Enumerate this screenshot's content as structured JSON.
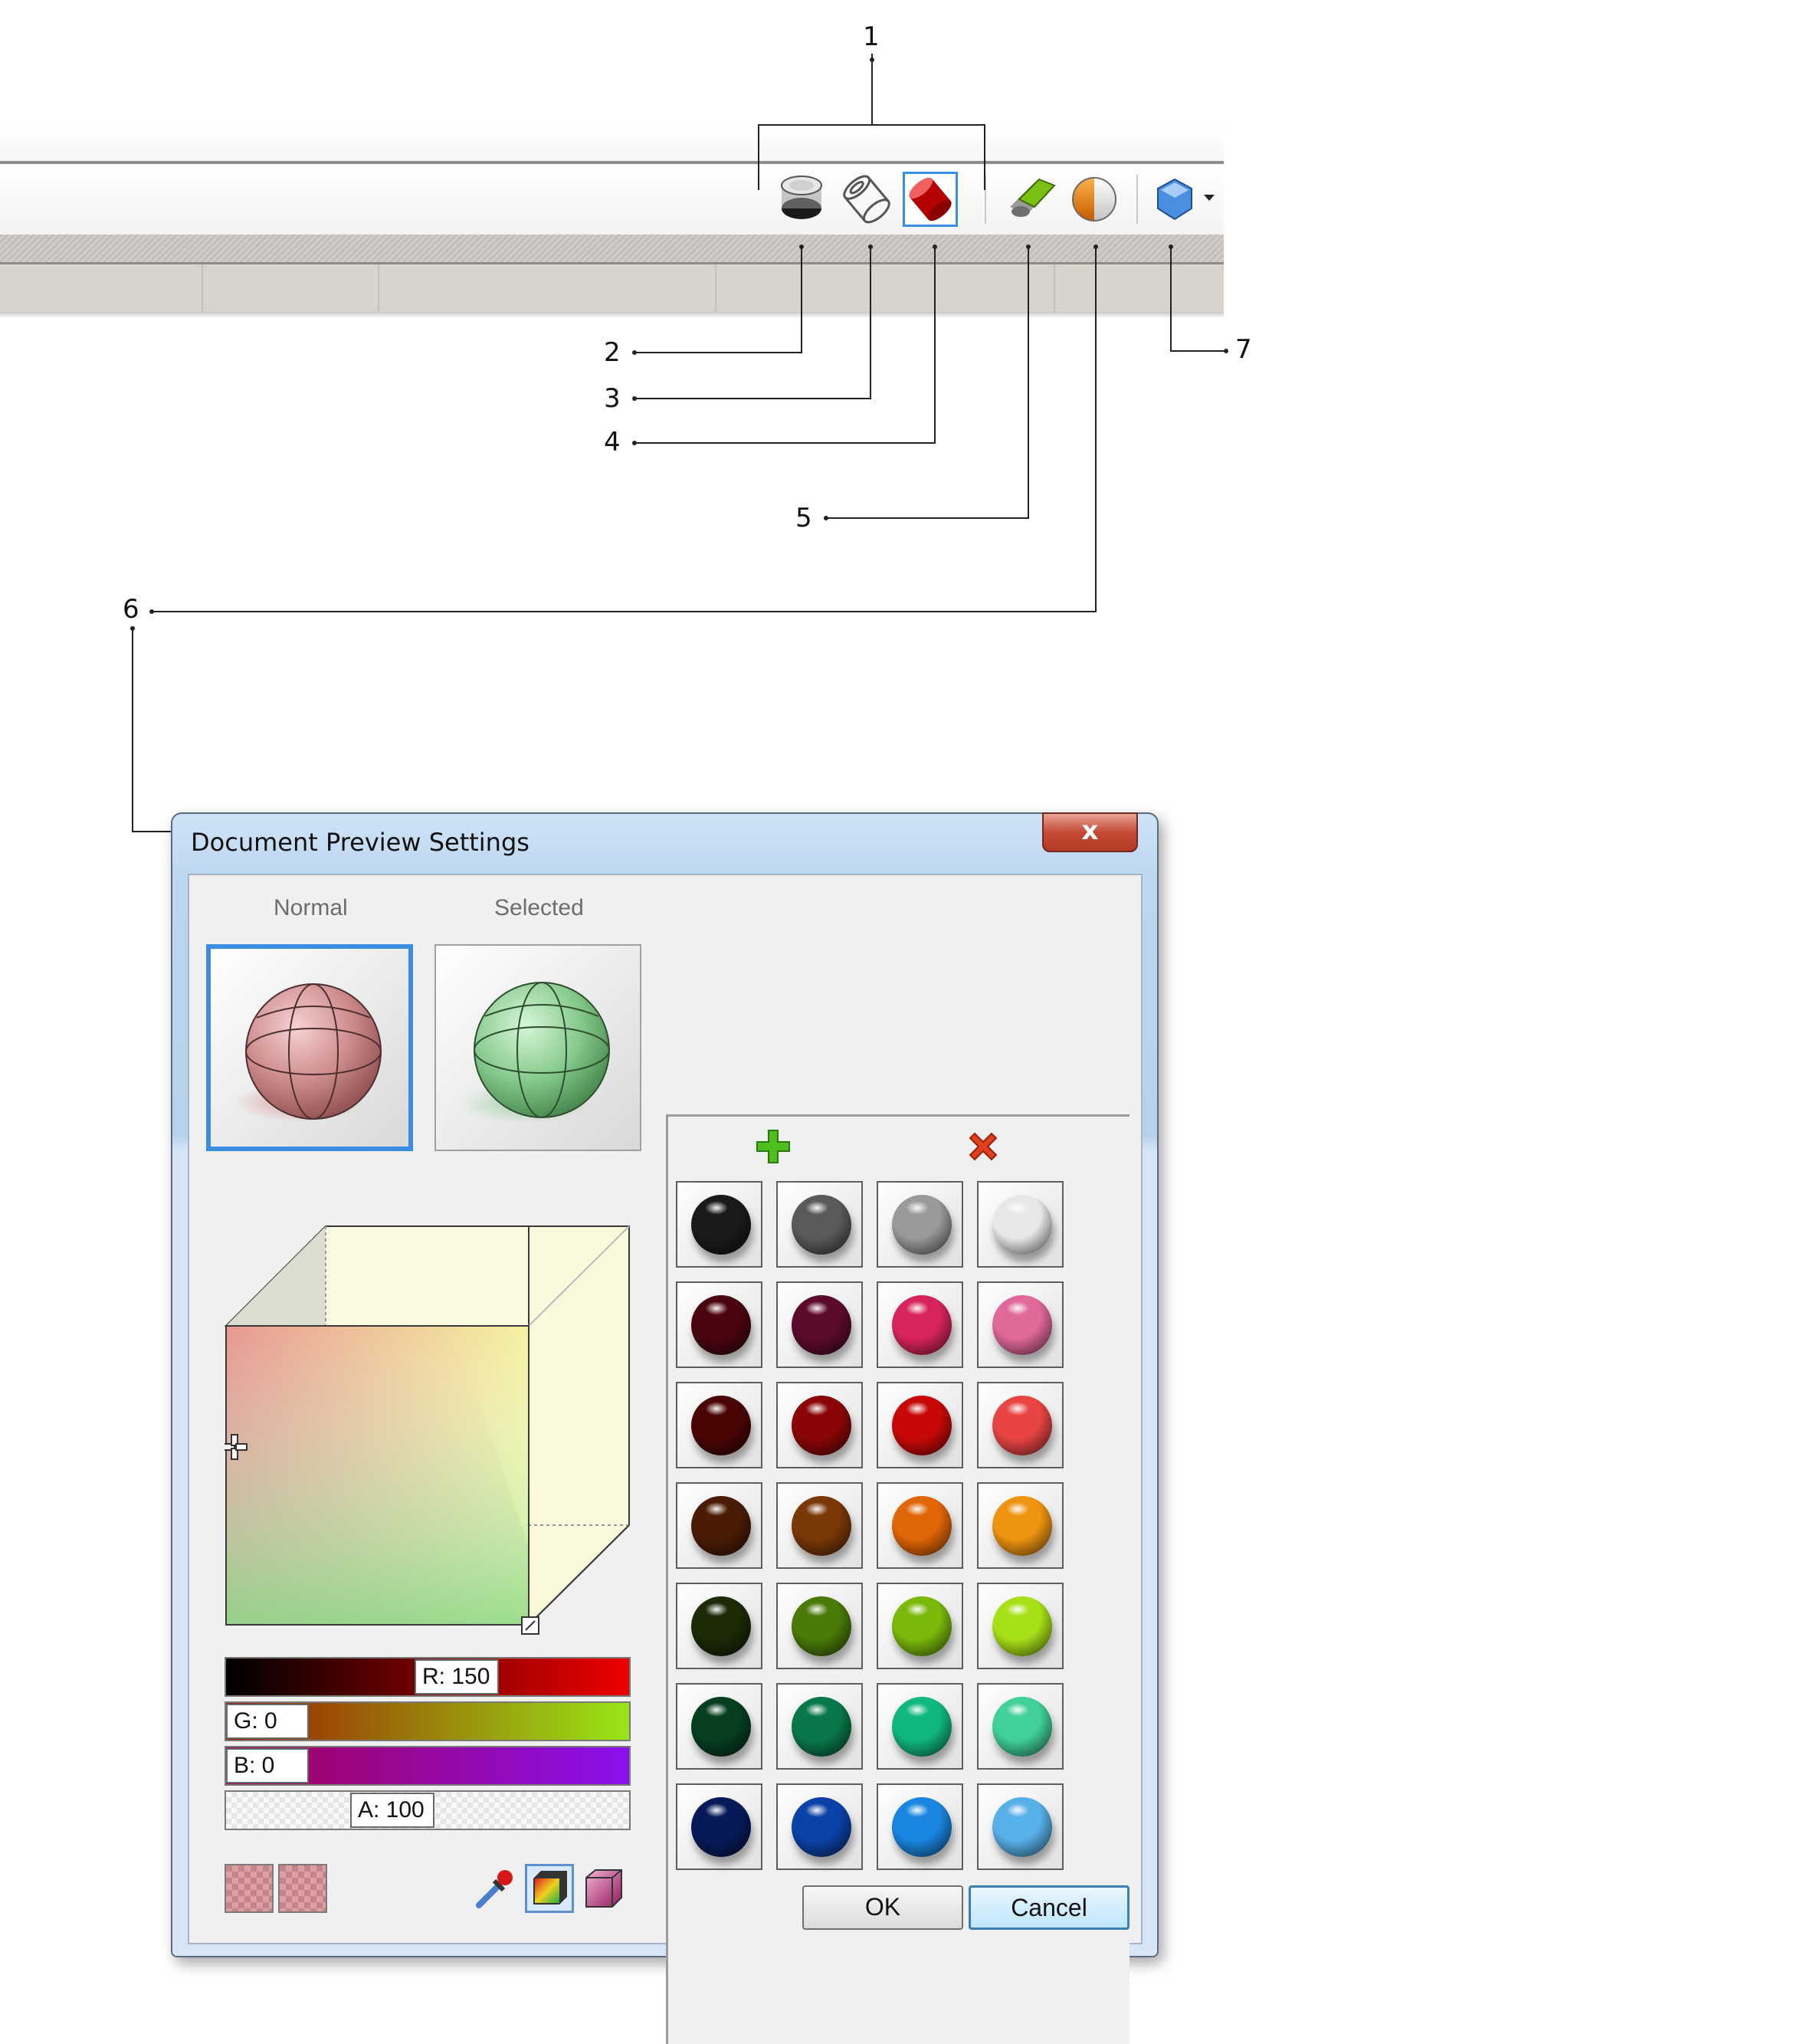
{
  "callouts": [
    "1",
    "2",
    "3",
    "4",
    "5",
    "6",
    "7"
  ],
  "toolbar": {
    "buttons": [
      {
        "name": "preview-mode-1",
        "icon": "shaded-ghost-cylinder-icon"
      },
      {
        "name": "preview-mode-2",
        "icon": "wireframe-cylinder-icon"
      },
      {
        "name": "preview-mode-3",
        "icon": "shaded-red-cylinder-icon",
        "active": true
      },
      {
        "name": "preview-selected-only",
        "icon": "green-ribbon-icon"
      },
      {
        "name": "document-preview-settings",
        "icon": "half-sphere-icon"
      },
      {
        "name": "display-quality",
        "icon": "blue-polygon-icon",
        "has_dropdown": true
      }
    ]
  },
  "dialog": {
    "title": "Document Preview Settings",
    "close_label": "x",
    "normal_label": "Normal",
    "selected_label": "Selected",
    "normal_color": "#c98888",
    "selected_color": "#8fcc95",
    "sliders": {
      "r": "R: 150",
      "g": "G: 0",
      "b": "B: 0",
      "a": "A: 100"
    },
    "ok_label": "OK",
    "cancel_label": "Cancel",
    "palette": {
      "add_icon": "plus-icon",
      "remove_icon": "x-icon",
      "swatches": [
        [
          "#1a1a1a",
          "#5a5a5a",
          "#9a9a9a",
          "#e8e8e8"
        ],
        [
          "#4a0410",
          "#5c0a2c",
          "#d8245c",
          "#e0689a"
        ],
        [
          "#4a0404",
          "#8a0606",
          "#c80808",
          "#e84444"
        ],
        [
          "#4a1c04",
          "#7a3806",
          "#e06606",
          "#ee9410"
        ],
        [
          "#1c2a06",
          "#4a7a08",
          "#7ab80a",
          "#a8e018"
        ],
        [
          "#063e20",
          "#08784a",
          "#10b880",
          "#40d098"
        ],
        [
          "#061a5a",
          "#0a42a8",
          "#1a86e0",
          "#58b0e8"
        ]
      ]
    }
  }
}
